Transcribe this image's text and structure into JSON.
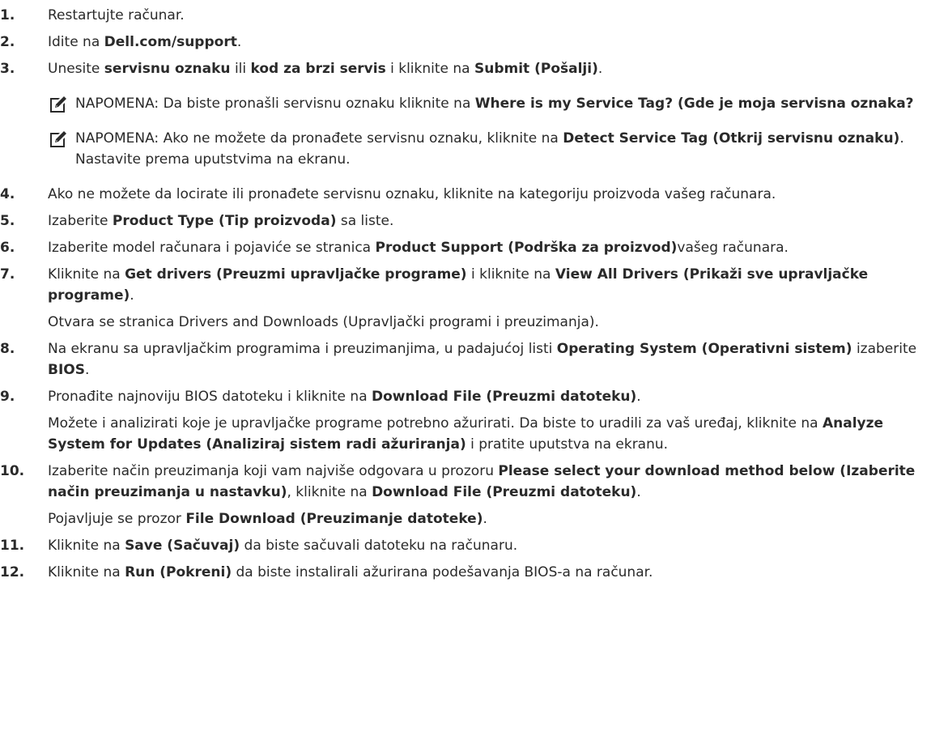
{
  "steps": [
    {
      "num": "1.",
      "parts": [
        {
          "t": "Restartujte računar.",
          "b": false
        }
      ]
    },
    {
      "num": "2.",
      "parts": [
        {
          "t": "Idite na ",
          "b": false
        },
        {
          "t": "Dell.com/support",
          "b": true
        },
        {
          "t": ".",
          "b": false
        }
      ]
    },
    {
      "num": "3.",
      "parts": [
        {
          "t": "Unesite ",
          "b": false
        },
        {
          "t": "servisnu oznaku",
          "b": true
        },
        {
          "t": " ili ",
          "b": false
        },
        {
          "t": "kod za brzi servis",
          "b": true
        },
        {
          "t": " i kliknite na ",
          "b": false
        },
        {
          "t": "Submit (Pošalji)",
          "b": true
        },
        {
          "t": ".",
          "b": false
        }
      ]
    },
    {
      "num": "4.",
      "parts": [
        {
          "t": "Ako ne možete da locirate ili pronađete servisnu oznaku, kliknite na kategoriju proizvoda vašeg računara.",
          "b": false
        }
      ]
    },
    {
      "num": "5.",
      "parts": [
        {
          "t": "Izaberite ",
          "b": false
        },
        {
          "t": "Product Type (Tip proizvoda)",
          "b": true
        },
        {
          "t": " sa liste.",
          "b": false
        }
      ]
    },
    {
      "num": "6.",
      "parts": [
        {
          "t": "Izaberite model računara i pojaviće se stranica ",
          "b": false
        },
        {
          "t": "Product Support (Podrška za proizvod)",
          "b": true
        },
        {
          "t": "vašeg računara.",
          "b": false
        }
      ]
    },
    {
      "num": "7.",
      "parts": [
        {
          "t": "Kliknite na ",
          "b": false
        },
        {
          "t": "Get drivers (Preuzmi upravljačke programe)",
          "b": true
        },
        {
          "t": " i kliknite na ",
          "b": false
        },
        {
          "t": "View All Drivers (Prikaži sve upravljačke programe)",
          "b": true
        },
        {
          "t": ".",
          "b": false
        }
      ],
      "extra": [
        {
          "t": "Otvara se stranica Drivers and Downloads (Upravljački programi i preuzimanja).",
          "b": false
        }
      ]
    },
    {
      "num": "8.",
      "parts": [
        {
          "t": "Na ekranu sa upravljačkim programima i preuzimanjima, u padajućoj listi ",
          "b": false
        },
        {
          "t": "Operating System (Operativni sistem)",
          "b": true
        },
        {
          "t": " izaberite ",
          "b": false
        },
        {
          "t": "BIOS",
          "b": true
        },
        {
          "t": ".",
          "b": false
        }
      ]
    },
    {
      "num": "9.",
      "parts": [
        {
          "t": "Pronađite najnoviju BIOS datoteku i kliknite na ",
          "b": false
        },
        {
          "t": "Download File (Preuzmi datoteku)",
          "b": true
        },
        {
          "t": ".",
          "b": false
        }
      ],
      "extra": [
        {
          "t": "Možete i analizirati koje je upravljačke programe potrebno ažurirati. Da biste to uradili za vaš uređaj, kliknite na ",
          "b": false
        },
        {
          "t": "Analyze System for Updates (Analiziraj sistem radi ažuriranja)",
          "b": true
        },
        {
          "t": " i pratite uputstva na ekranu.",
          "b": false
        }
      ]
    },
    {
      "num": "10.",
      "parts": [
        {
          "t": "Izaberite način preuzimanja koji vam najviše odgovara u prozoru ",
          "b": false
        },
        {
          "t": "Please select your download method below (Izaberite način preuzimanja u nastavku)",
          "b": true
        },
        {
          "t": ", kliknite na ",
          "b": false
        },
        {
          "t": "Download File (Preuzmi datoteku)",
          "b": true
        },
        {
          "t": ".",
          "b": false
        }
      ],
      "extra": [
        {
          "t": "Pojavljuje se prozor ",
          "b": false
        },
        {
          "t": "File Download (Preuzimanje datoteke)",
          "b": true
        },
        {
          "t": ".",
          "b": false
        }
      ]
    },
    {
      "num": "11.",
      "parts": [
        {
          "t": "Kliknite na ",
          "b": false
        },
        {
          "t": "Save (Sačuvaj)",
          "b": true
        },
        {
          "t": " da biste sačuvali datoteku na računaru.",
          "b": false
        }
      ]
    },
    {
      "num": "12.",
      "parts": [
        {
          "t": "Kliknite na ",
          "b": false
        },
        {
          "t": "Run (Pokreni)",
          "b": true
        },
        {
          "t": " da biste instalirali ažurirana podešavanja BIOS-a na računar.",
          "b": false
        }
      ]
    }
  ],
  "notes": [
    {
      "after_step": 2,
      "icon": "pencil-note-icon",
      "parts": [
        {
          "t": "NAPOMENA:",
          "b": false
        },
        {
          "t": " Da biste pronašli servisnu oznaku kliknite na ",
          "b": false
        },
        {
          "t": "Where is my Service Tag? (Gde je moja servisna oznaka?",
          "b": true
        }
      ]
    },
    {
      "after_step": 2,
      "icon": "pencil-note-icon",
      "parts": [
        {
          "t": "NAPOMENA:",
          "b": false
        },
        {
          "t": " Ako ne možete da pronađete servisnu oznaku, kliknite na ",
          "b": false
        },
        {
          "t": "Detect Service Tag (Otkrij servisnu oznaku)",
          "b": true
        },
        {
          "t": ". Nastavite prema uputstvima na ekranu.",
          "b": false
        }
      ]
    }
  ]
}
